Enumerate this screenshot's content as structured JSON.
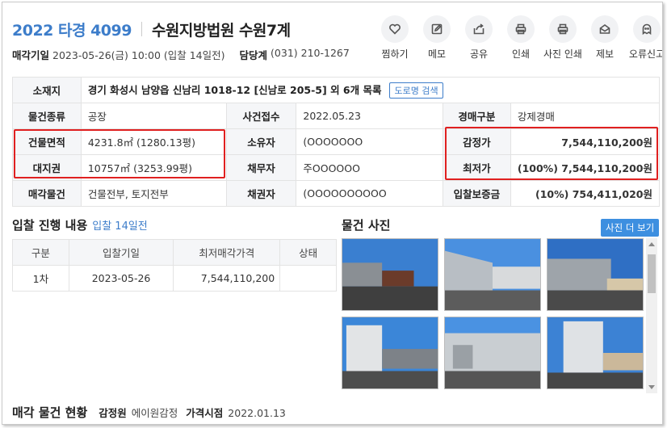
{
  "header": {
    "case_no": "2022 타경 4099",
    "court": "수원지방법원 수원7계",
    "sale_date_label": "매각기일",
    "sale_date_value": "2023-05-26(금) 10:00 (입찰 14일전)",
    "contact_label": "담당계",
    "contact_value": "(031) 210-1267"
  },
  "actions": [
    {
      "label": "찜하기",
      "icon": "heart-icon"
    },
    {
      "label": "메모",
      "icon": "memo-icon"
    },
    {
      "label": "공유",
      "icon": "share-icon"
    },
    {
      "label": "인쇄",
      "icon": "print-icon"
    },
    {
      "label": "사진 인쇄",
      "icon": "photo-print-icon"
    },
    {
      "label": "제보",
      "icon": "report-icon"
    },
    {
      "label": "오류신고",
      "icon": "ghost-icon"
    }
  ],
  "info": {
    "location_label": "소재지",
    "location_value": "경기 화성시 남양읍 신남리 1018-12 [신남로 205-5] 외 6개 목록",
    "road_button": "도로명 검색",
    "type_label": "물건종류",
    "type_value": "공장",
    "case_received_label": "사건접수",
    "case_received_value": "2022.05.23",
    "auction_kind_label": "경매구분",
    "auction_kind_value": "강제경매",
    "building_area_label": "건물면적",
    "building_area_value": "4231.8㎡ (1280.13평)",
    "owner_label": "소유자",
    "owner_value": "(OOOOOOO",
    "appraisal_label": "감정가",
    "appraisal_value": "7,544,110,200원",
    "land_right_label": "대지권",
    "land_right_value": "10757㎡ (3253.99평)",
    "debtor_label": "채무자",
    "debtor_value": "주OOOOOO",
    "min_price_label": "최저가",
    "min_price_value": "(100%) 7,544,110,200원",
    "sale_items_label": "매각물건",
    "sale_items_value": "건물전부, 토지전부",
    "creditor_label": "채권자",
    "creditor_value": "(OOOOOOOOOO",
    "deposit_label": "입찰보증금",
    "deposit_value": "(10%) 754,411,020원"
  },
  "bid": {
    "title": "입찰 진행 내용",
    "note": "입찰 14일전",
    "headers": [
      "구분",
      "입찰기일",
      "최저매각가격",
      "상태"
    ],
    "rows": [
      [
        "1차",
        "2023-05-26",
        "7,544,110,200",
        ""
      ]
    ]
  },
  "photos": {
    "title": "물건 사진",
    "more_button": "사진 더 보기"
  },
  "bottom": {
    "title": "매각 물건 현황",
    "appraiser_label": "감정원",
    "appraiser_value": "에이원감정",
    "price_date_label": "가격시점",
    "price_date_value": "2022.01.13"
  },
  "colors": {
    "accent": "#3d7dca",
    "highlight_box": "#e02020",
    "header_bg": "#f5f6f8"
  }
}
